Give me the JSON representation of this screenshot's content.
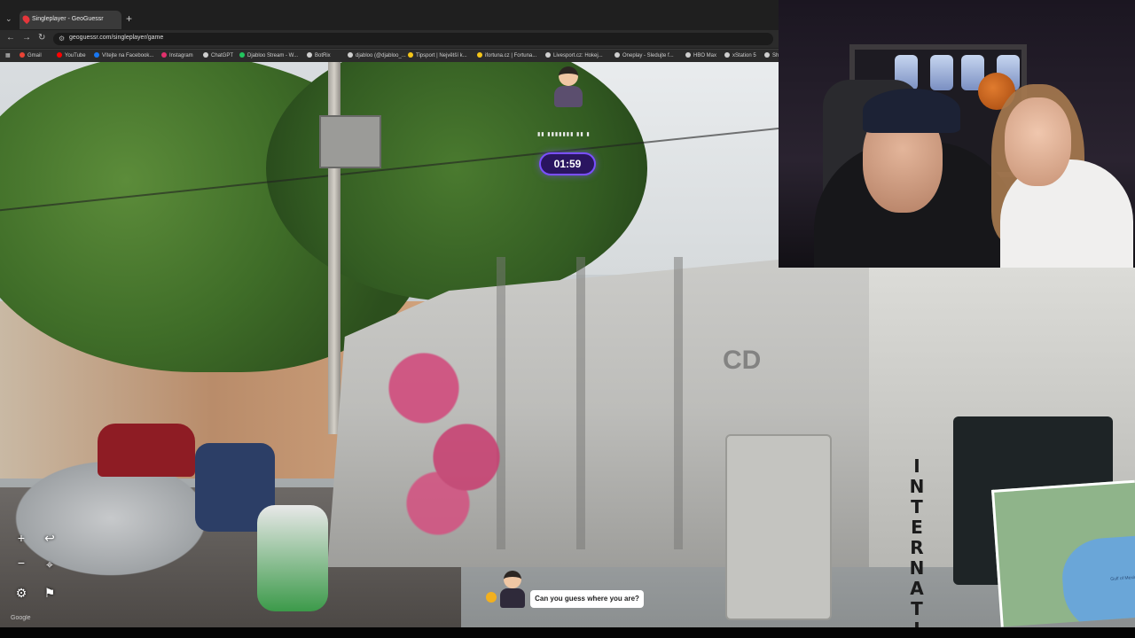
{
  "browser": {
    "tab_title": "Singleplayer - GeoGuessr",
    "tab_close": "✕",
    "new_tab": "+",
    "url": "geoguessr.com/singleplayer/game",
    "bookmarks": [
      {
        "label": "Gmail",
        "color": "#ea4335"
      },
      {
        "label": "YouTube",
        "color": "#ff0000"
      },
      {
        "label": "Vítejte na Facebook...",
        "color": "#1877f2"
      },
      {
        "label": "Instagram",
        "color": "#e1306c"
      },
      {
        "label": "ChatGPT",
        "color": "#cfcfcf"
      },
      {
        "label": "Djabloo Stream - W...",
        "color": "#22c55e"
      },
      {
        "label": "BotRix",
        "color": "#cfcfcf"
      },
      {
        "label": "djabloo (@djabloo_...",
        "color": "#cfcfcf"
      },
      {
        "label": "Tipsport | Největší k...",
        "color": "#f5c518"
      },
      {
        "label": "ifortuna.cz | Fortuna...",
        "color": "#f5c518"
      },
      {
        "label": "Livesport.cz: Hokej...",
        "color": "#cfcfcf"
      },
      {
        "label": "Oneplay - Sledujte f...",
        "color": "#cfcfcf"
      },
      {
        "label": "HBO Max",
        "color": "#cfcfcf"
      },
      {
        "label": "xStation 5",
        "color": "#cfcfcf"
      },
      {
        "label": "Shu",
        "color": "#cfcfcf"
      }
    ]
  },
  "game": {
    "timer": "01:59",
    "prompt": "Can you guess where you are?",
    "attribution": "Google",
    "truck_text": "INTERNATIO",
    "truck_logo": "CD",
    "minimap_label": "Gulf of Mexico"
  },
  "colors": {
    "timer_bg": "#2a1560",
    "timer_border": "#7a4fff"
  }
}
